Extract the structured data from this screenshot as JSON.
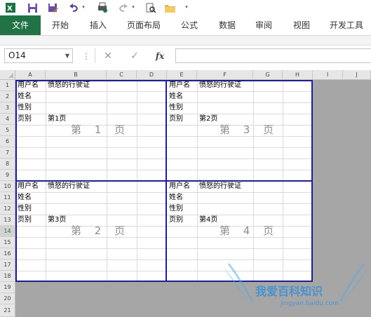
{
  "quick_access": {
    "icons": [
      "excel-logo-icon",
      "save-icon",
      "save-as-icon",
      "undo-icon",
      "print-preview-icon",
      "redo-icon",
      "print-preview-magnifier-icon",
      "open-folder-icon",
      "customize-toolbar-icon"
    ]
  },
  "ribbon": {
    "tabs": [
      {
        "label": "文件"
      },
      {
        "label": "开始"
      },
      {
        "label": "插入"
      },
      {
        "label": "页面布局"
      },
      {
        "label": "公式"
      },
      {
        "label": "数据"
      },
      {
        "label": "审阅"
      },
      {
        "label": "视图"
      },
      {
        "label": "开发工具"
      }
    ],
    "accent": "#217346"
  },
  "formula_bar": {
    "name_box": "O14",
    "fx_label": "fx",
    "cancel_symbol": "✕",
    "confirm_symbol": "✓",
    "value": ""
  },
  "grid": {
    "columns": [
      "A",
      "B",
      "C",
      "D",
      "E",
      "F",
      "G",
      "H",
      "I",
      "J"
    ],
    "rows": [
      "1",
      "2",
      "3",
      "4",
      "5",
      "6",
      "7",
      "8",
      "9",
      "10",
      "11",
      "12",
      "13",
      "14",
      "15",
      "16",
      "17",
      "18",
      "19",
      "20",
      "21"
    ],
    "selected_row": "14",
    "page_border_color": "#1f1f8f",
    "pages": [
      {
        "user_label": "用户名",
        "user_value": "愤怒的行驶证",
        "name_label": "姓名",
        "gender_label": "性别",
        "page_label": "页别",
        "page_value": "第1页",
        "watermark": "第 1 页"
      },
      {
        "user_label": "用户名",
        "user_value": "愤怒的行驶证",
        "name_label": "姓名",
        "gender_label": "性别",
        "page_label": "页别",
        "page_value": "第2页",
        "watermark": "第 3 页"
      },
      {
        "user_label": "用户名",
        "user_value": "愤怒的行驶证",
        "name_label": "姓名",
        "gender_label": "性别",
        "page_label": "页别",
        "page_value": "第3页",
        "watermark": "第 2 页"
      },
      {
        "user_label": "用户名",
        "user_value": "愤怒的行驶证",
        "name_label": "姓名",
        "gender_label": "性别",
        "page_label": "页别",
        "page_value": "第4页",
        "watermark": "第 4 页"
      }
    ]
  },
  "site_watermark": {
    "title": "我爱百科知识",
    "url": "jingyan.baidu.com"
  }
}
